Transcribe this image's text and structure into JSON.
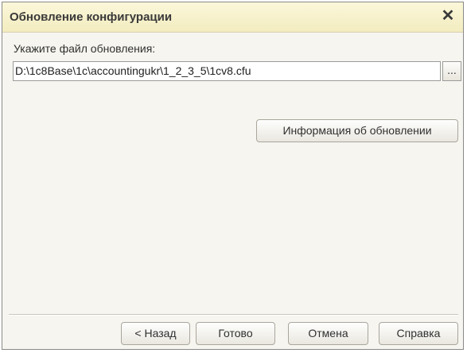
{
  "window": {
    "title": "Обновление конфигурации",
    "close_glyph": "✕"
  },
  "form": {
    "prompt": "Укажите файл обновления:",
    "file_path": "D:\\1c8Base\\1c\\accountingukr\\1_2_3_5\\1cv8.cfu",
    "browse_label": "...",
    "info_button": "Информация об обновлении"
  },
  "footer": {
    "back_label": "< Назад",
    "finish_label": "Готово",
    "cancel_label": "Отмена",
    "help_label": "Справка"
  },
  "colors": {
    "title_bar": "#f3ecc0",
    "dialog_background": "#f6f5ef"
  }
}
